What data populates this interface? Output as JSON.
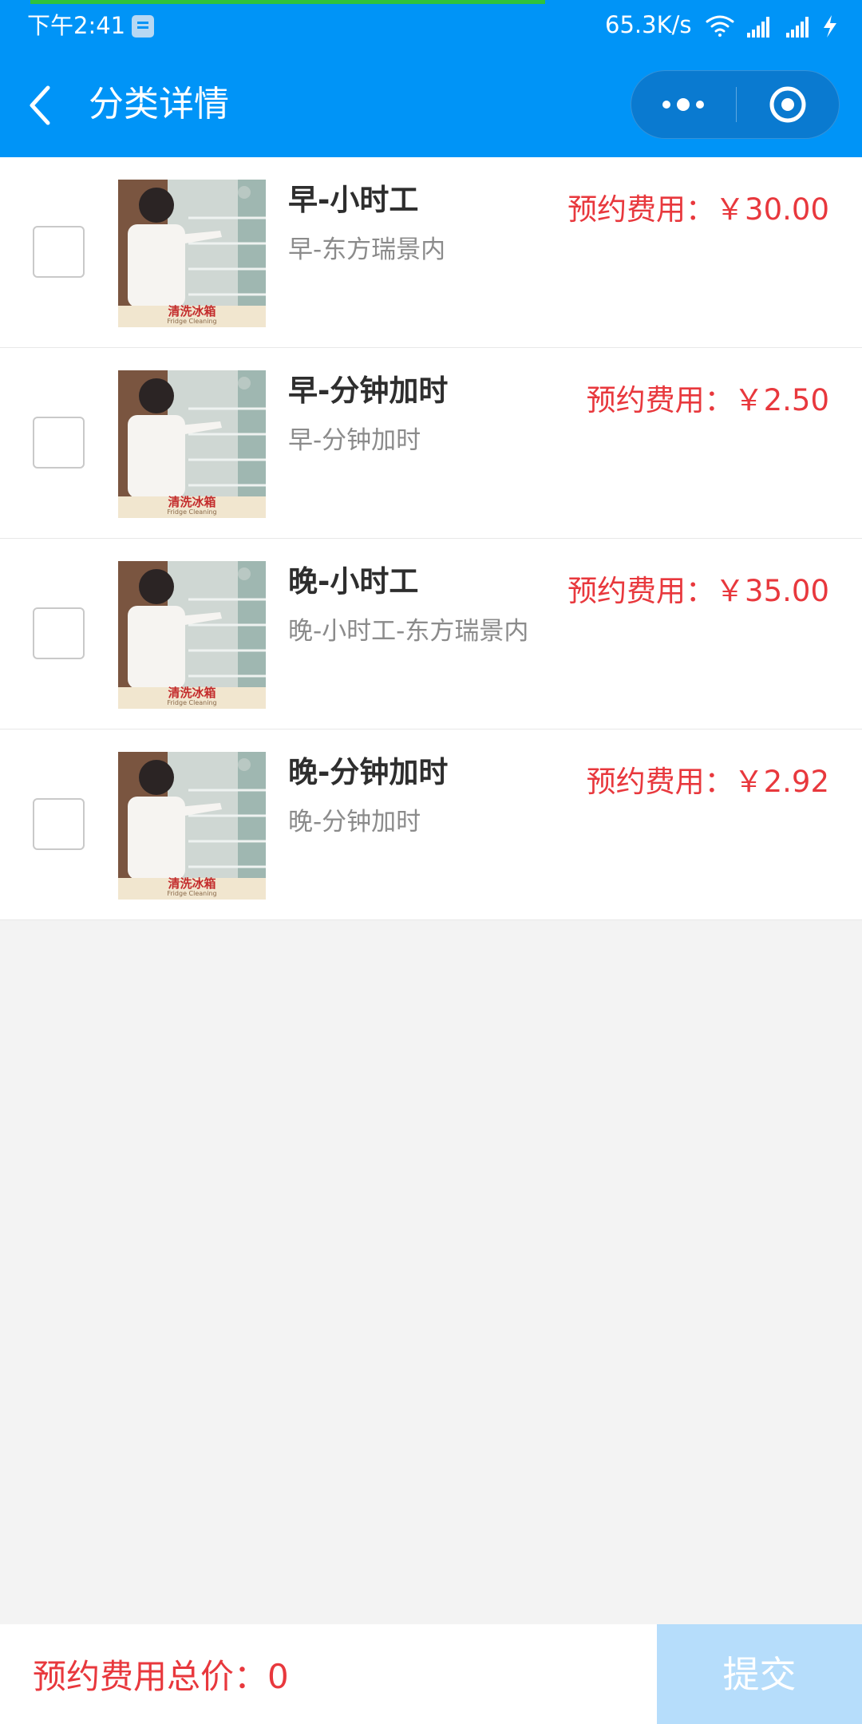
{
  "status_bar": {
    "time": "下午2:41",
    "network_speed": "65.3K/s",
    "icons": [
      "message-icon",
      "wifi-icon",
      "signal-icon",
      "signal-icon",
      "charging-icon"
    ]
  },
  "header": {
    "title": "分类详情"
  },
  "items": [
    {
      "title": "早-小时工",
      "desc": "早-东方瑞景内",
      "price": "预约费用：￥30.00",
      "image_caption": "清洗冰箱",
      "image_subcaption": "Fridge Cleaning",
      "checked": false
    },
    {
      "title": "早-分钟加时",
      "desc": "早-分钟加时",
      "price": "预约费用：￥2.50",
      "image_caption": "清洗冰箱",
      "image_subcaption": "Fridge Cleaning",
      "checked": false
    },
    {
      "title": "晚-小时工",
      "desc": "晚-小时工-东方瑞景内",
      "price": "预约费用：￥35.00",
      "image_caption": "清洗冰箱",
      "image_subcaption": "Fridge Cleaning",
      "checked": false
    },
    {
      "title": "晚-分钟加时",
      "desc": "晚-分钟加时",
      "price": "预约费用：￥2.92",
      "image_caption": "清洗冰箱",
      "image_subcaption": "Fridge Cleaning",
      "checked": false
    }
  ],
  "footer": {
    "total_label": "预约费用总价：0",
    "submit_label": "提交"
  },
  "colors": {
    "primary": "#0094f7",
    "price": "#e8383d",
    "submit_disabled": "#b6ddfb",
    "progress": "#2fc23d"
  }
}
